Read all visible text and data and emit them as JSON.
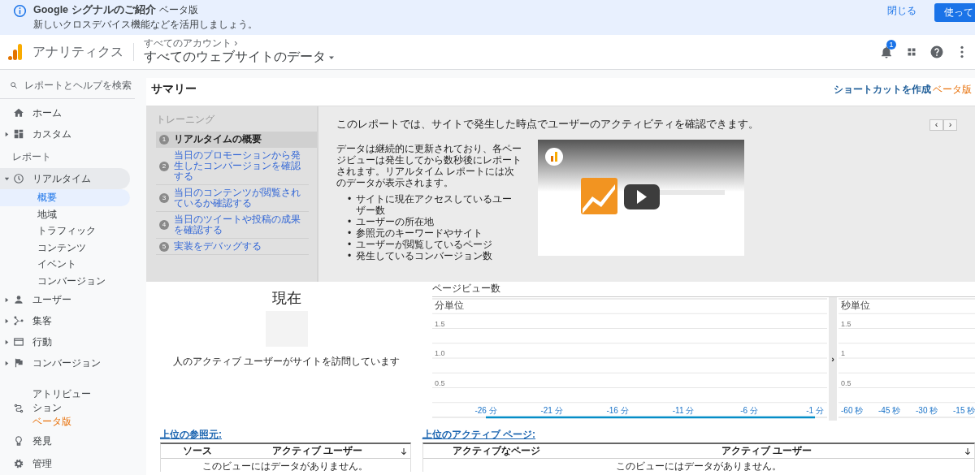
{
  "banner": {
    "title": "Google シグナルのご紹介",
    "badge": "ベータ版",
    "message": "新しいクロスデバイス機能などを活用しましょう。",
    "dismiss": "閉じる",
    "action": "使って"
  },
  "header": {
    "product": "アナリティクス",
    "breadcrumb": "すべてのアカウント ›",
    "view": "すべてのウェブサイトのデータ",
    "notifications": "1"
  },
  "sidebar": {
    "search": {
      "placeholder": "レポートとヘルプを検索"
    },
    "top_items": [
      {
        "label": "ホーム"
      },
      {
        "label": "カスタム",
        "expanded": false
      }
    ],
    "section_label": "レポート",
    "report_items": [
      {
        "label": "リアルタイム",
        "expanded": true,
        "selected": true,
        "children": [
          {
            "label": "概要",
            "selected": true
          },
          {
            "label": "地域",
            "selected": false
          },
          {
            "label": "トラフィック",
            "selected": false
          },
          {
            "label": "コンテンツ",
            "selected": false
          },
          {
            "label": "イベント",
            "selected": false
          },
          {
            "label": "コンバージョン",
            "selected": false
          }
        ]
      },
      {
        "label": "ユーザー",
        "expanded": false,
        "selected": false
      },
      {
        "label": "集客",
        "expanded": false,
        "selected": false
      },
      {
        "label": "行動",
        "expanded": false,
        "selected": false
      },
      {
        "label": "コンバージョン",
        "expanded": false,
        "selected": false
      }
    ],
    "bottom_items": [
      {
        "label": "アトリビューション",
        "badge": "ベータ版"
      },
      {
        "label": "発見"
      },
      {
        "label": "管理"
      }
    ]
  },
  "page": {
    "title": "サマリー",
    "shortcut": "ショートカットを作成",
    "shortcut_badge": "ベータ版"
  },
  "training": {
    "label": "トレーニング",
    "steps": [
      {
        "number": "1",
        "label": "リアルタイムの概要",
        "selected": true
      },
      {
        "number": "2",
        "label": "当日のプロモーションから発生したコンバージョンを確認する",
        "selected": false
      },
      {
        "number": "3",
        "label": "当日のコンテンツが閲覧されているか確認する",
        "selected": false
      },
      {
        "number": "4",
        "label": "当日のツイートや投稿の成果を確認する",
        "selected": false
      },
      {
        "number": "5",
        "label": "実装をデバッグする",
        "selected": false
      }
    ],
    "heading": "このレポートでは、サイトで発生した時点でユーザーのアクティビティを確認できます。",
    "prev": "‹",
    "next": "›",
    "description": "データは継続的に更新されており、各ページビューは発生してから数秒後にレポートされます。リアルタイム レポートには次のデータが表示されます。",
    "bullets": [
      {
        "marker": "•",
        "text": "サイトに現在アクセスしているユーザー数"
      },
      {
        "marker": "•",
        "text": "ユーザーの所在地"
      },
      {
        "marker": "•",
        "text": "参照元のキーワードやサイト"
      },
      {
        "marker": "•",
        "text": "ユーザーが閲覧しているページ"
      },
      {
        "marker": "•",
        "text": "発生しているコンバージョン数"
      }
    ]
  },
  "current": {
    "title": "現在",
    "caption": "人のアクティブ ユーザーがサイトを訪問しています"
  },
  "pageviews": {
    "title": "ページビュー数",
    "toggle": "›",
    "minutes": {
      "chart_data": {
        "type": "line",
        "title": "分単位",
        "categories": [
          "-26 分",
          "-21 分",
          "-16 分",
          "-11 分",
          "-6 分",
          "-1 分"
        ],
        "series": [
          {
            "color": "#058dc7",
            "values": [
              0,
              0,
              0,
              0,
              0,
              0
            ]
          }
        ],
        "grid": true,
        "ylim": [
          0,
          2
        ],
        "yticks": [
          {
            "value": 0.5,
            "label": "0.5"
          },
          {
            "value": 1,
            "label": "1.0"
          },
          {
            "value": 1.5,
            "label": "1.5"
          }
        ]
      }
    },
    "seconds": {
      "chart_data": {
        "type": "line",
        "title": "秒単位",
        "categories": [
          "-60 秒",
          "-45 秒",
          "-30 秒",
          "-15 秒"
        ],
        "grid": true,
        "ylim": [
          0,
          2
        ],
        "yticks": [
          {
            "value": 0.5,
            "label": "0.5"
          },
          {
            "value": 1,
            "label": "1"
          },
          {
            "value": 1.5,
            "label": "1.5"
          }
        ]
      }
    }
  },
  "referrers": {
    "title": "上位の参照元:",
    "columns": [
      "ソース",
      "アクティブ ユーザー"
    ],
    "empty": "このビューにはデータがありません。"
  },
  "pages": {
    "title": "上位のアクティブ ページ:",
    "columns": [
      "アクティブなページ",
      "アクティブ ユーザー"
    ],
    "empty": "このビューにはデータがありません。"
  }
}
